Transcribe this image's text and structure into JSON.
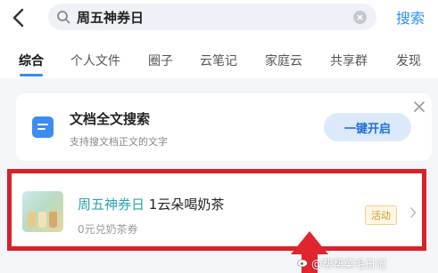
{
  "search": {
    "query": "周五神券日",
    "button_label": "搜索"
  },
  "tabs": [
    {
      "label": "综合",
      "active": true
    },
    {
      "label": "个人文件",
      "active": false
    },
    {
      "label": "圈子",
      "active": false
    },
    {
      "label": "云笔记",
      "active": false
    },
    {
      "label": "家庭云",
      "active": false
    },
    {
      "label": "共享群",
      "active": false
    },
    {
      "label": "发现",
      "active": false
    }
  ],
  "fulltext_card": {
    "title": "文档全文搜索",
    "subtitle": "支持搜文档正文的文字",
    "button_label": "一键开启"
  },
  "result": {
    "title_highlight": "周五神券日",
    "title_rest": " 1云朵喝奶茶",
    "subtitle": "0元兑奶茶券",
    "badge": "活动"
  },
  "watermark": "@帮帮菜毛日记",
  "colors": {
    "accent": "#2f8ff5",
    "highlight_border": "#d8222b",
    "badge_text": "#c99a2e"
  }
}
